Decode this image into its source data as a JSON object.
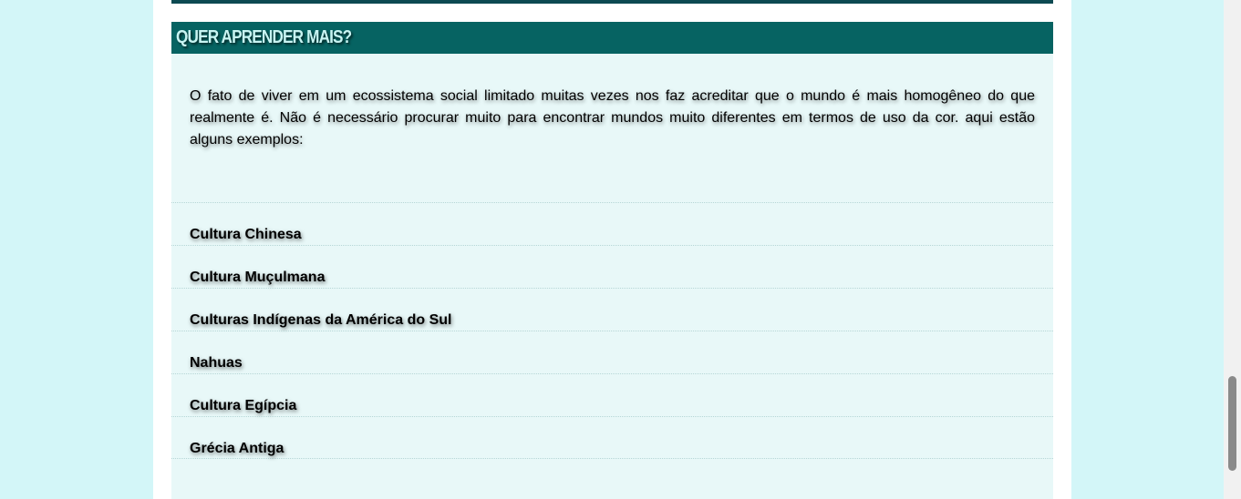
{
  "section": {
    "title": "QUER APRENDER MAIS?",
    "intro": "O fato de viver em um ecossistema social limitado muitas vezes nos faz acreditar que o mundo é mais homogêneo do que realmente é. Não é necessário procurar muito para encontrar mundos muito diferentes em termos de uso da cor. aqui estão alguns exemplos:"
  },
  "links": [
    {
      "label": "Cultura Chinesa"
    },
    {
      "label": "Cultura Muçulmana"
    },
    {
      "label": "Culturas Indígenas da América do Sul"
    },
    {
      "label": "Nahuas"
    },
    {
      "label": "Cultura Egípcia"
    },
    {
      "label": "Grécia Antiga"
    }
  ],
  "colors": {
    "page_background": "#d3f6f8",
    "header_background": "#066362",
    "header_text": "#c8f4f2",
    "content_background": "#e8f8f8",
    "top_bar": "#0d4a52"
  }
}
